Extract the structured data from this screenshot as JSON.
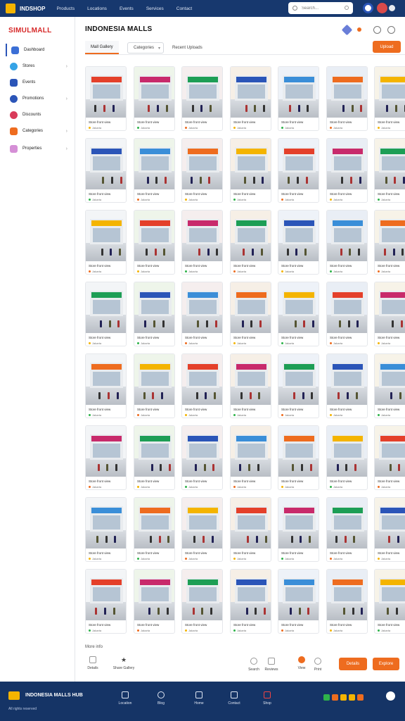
{
  "topbar": {
    "brand": "INDSHOP",
    "nav": [
      "Products",
      "Locations",
      "Events",
      "Services",
      "Contact"
    ],
    "search_placeholder": "Search..."
  },
  "sidebar": {
    "logo": "SIMULMALL",
    "items": [
      {
        "label": "Dashboard"
      },
      {
        "label": "Stores"
      },
      {
        "label": "Events"
      },
      {
        "label": "Promotions"
      },
      {
        "label": "Discounts"
      },
      {
        "label": "Categories"
      },
      {
        "label": "Properties"
      }
    ]
  },
  "main": {
    "title": "INDONESIA MALLS",
    "tabs": [
      {
        "label": "Mall Gallery"
      },
      {
        "label": "Categories"
      },
      {
        "label": "Recent Uploads"
      }
    ],
    "cta_label": "Upload",
    "grid": {
      "columns": 7,
      "rows": 8,
      "caption": "Store front view",
      "meta": "Jakarta"
    },
    "footer_label": "More info",
    "footer_left": [
      "Details",
      "Share Gallery"
    ],
    "footer_right": [
      "Search",
      "Reviews",
      "View",
      "Print"
    ],
    "btn_primary": "Details",
    "btn_secondary": "Explore"
  },
  "bottombar": {
    "brand": "INDONESIA MALLS HUB",
    "sub": "All rights reserved",
    "items": [
      {
        "label": "Location"
      },
      {
        "label": "Blog"
      },
      {
        "label": "Home"
      },
      {
        "label": "Contact"
      },
      {
        "label": "Shop"
      }
    ]
  }
}
